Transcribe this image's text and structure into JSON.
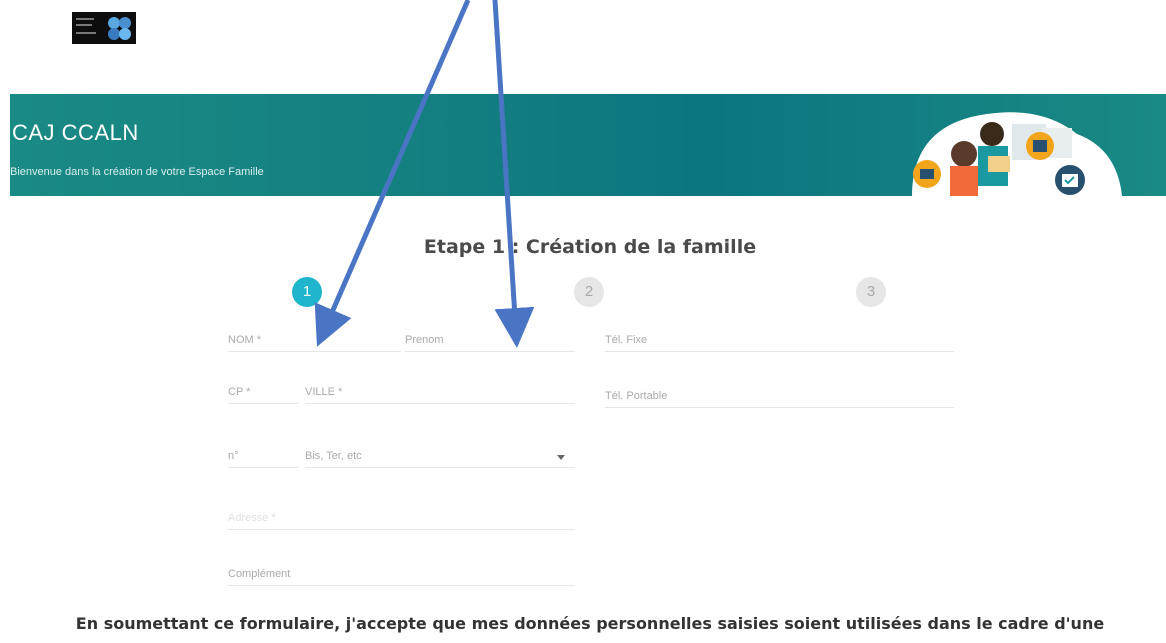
{
  "header": {
    "title": "CAJ CCALN",
    "subtitle": "Bienvenue dans la création de votre Espace Famille"
  },
  "step": {
    "title": "Etape 1 : Création de la famille",
    "indicators": [
      "1",
      "2",
      "3"
    ],
    "active": 1
  },
  "form": {
    "nom": "NOM *",
    "prenom": "Prenom",
    "tel_fixe": "Tél. Fixe",
    "cp": "CP *",
    "ville": "VILLE *",
    "tel_portable": "Tél. Portable",
    "numero": "n°",
    "bis_ter": "Bis, Ter, etc",
    "adresse": "Adresse *",
    "complement": "Complément"
  },
  "consent": {
    "line1": "En soumettant ce formulaire, j'accepte que mes données personnelles saisies soient utilisées dans le cadre d'une"
  },
  "colors": {
    "banner": "#137e80",
    "step_active": "#1fb5cc",
    "arrow": "#4a74c4"
  }
}
